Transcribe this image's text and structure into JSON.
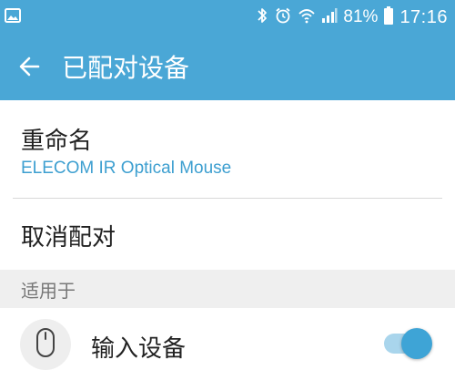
{
  "status_bar": {
    "battery_percent": "81%",
    "time": "17:16",
    "icons": [
      "image-notification-icon",
      "bluetooth-icon",
      "alarm-icon",
      "wifi-icon",
      "signal-icon",
      "battery-icon"
    ]
  },
  "app_bar": {
    "title": "已配对设备",
    "back_icon": "arrow-left-icon",
    "color": "#4aa7d6"
  },
  "rename": {
    "label": "重命名",
    "device_name": "ELECOM IR Optical Mouse"
  },
  "unpair": {
    "label": "取消配对"
  },
  "section": {
    "label": "适用于"
  },
  "input_device": {
    "label": "输入设备",
    "icon": "mouse-icon",
    "enabled": true
  }
}
